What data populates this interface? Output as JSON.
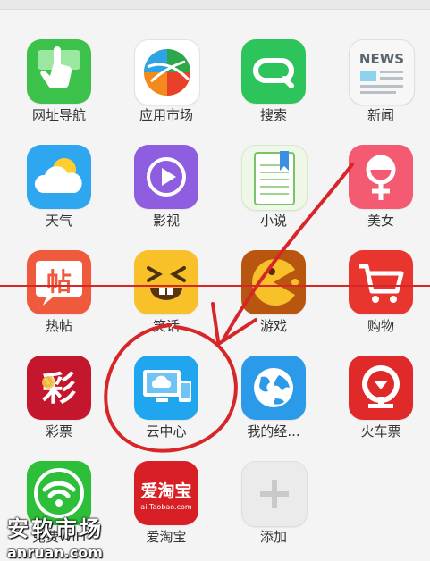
{
  "apps": [
    {
      "label": "网址导航",
      "icon": "hand-pointer-icon",
      "color": "#3cc24a"
    },
    {
      "label": "应用市场",
      "icon": "colorful-ball-icon",
      "color": "#ffffff"
    },
    {
      "label": "搜索",
      "icon": "search-q-icon",
      "color": "#2dc55b"
    },
    {
      "label": "新闻",
      "icon": "newspaper-icon",
      "color": "#f7f7f7"
    },
    {
      "label": "天气",
      "icon": "weather-icon",
      "color": "#2ea7f0"
    },
    {
      "label": "影视",
      "icon": "play-icon",
      "color": "#8e5de0"
    },
    {
      "label": "小说",
      "icon": "notebook-icon",
      "color": "#eef7e8"
    },
    {
      "label": "美女",
      "icon": "female-icon",
      "color": "#f45a72"
    },
    {
      "label": "热帖",
      "icon": "hot-post-icon",
      "color": "#f05a3c"
    },
    {
      "label": "笑话",
      "icon": "laughing-face-icon",
      "color": "#f8c12a"
    },
    {
      "label": "游戏",
      "icon": "game-pacman-icon",
      "color": "#b8550e"
    },
    {
      "label": "购物",
      "icon": "shopping-cart-icon",
      "color": "#e8362f"
    },
    {
      "label": "彩票",
      "icon": "lottery-icon",
      "color": "#c4172d"
    },
    {
      "label": "云中心",
      "icon": "cloud-center-icon",
      "color": "#1fa6ef"
    },
    {
      "label": "我的经...",
      "icon": "globe-icon",
      "color": "#2b9be9"
    },
    {
      "label": "火车票",
      "icon": "train-ticket-icon",
      "color": "#e02a2a"
    },
    {
      "label": "免费WiFi",
      "icon": "wifi-icon",
      "color": "#2ebf3a"
    },
    {
      "label": "爱淘宝",
      "icon": "taobao-icon",
      "color": "#d81f26",
      "text": "爱淘宝",
      "subtext": "ai.Taobao.com"
    },
    {
      "label": "添加",
      "icon": "add-icon",
      "color": "#ebebeb"
    }
  ],
  "lottery_badge_text": "彩",
  "hot_post_text": "帖",
  "news_text": "NEWS",
  "watermark": {
    "line1": "安软市场",
    "line2": "anruan.com"
  }
}
